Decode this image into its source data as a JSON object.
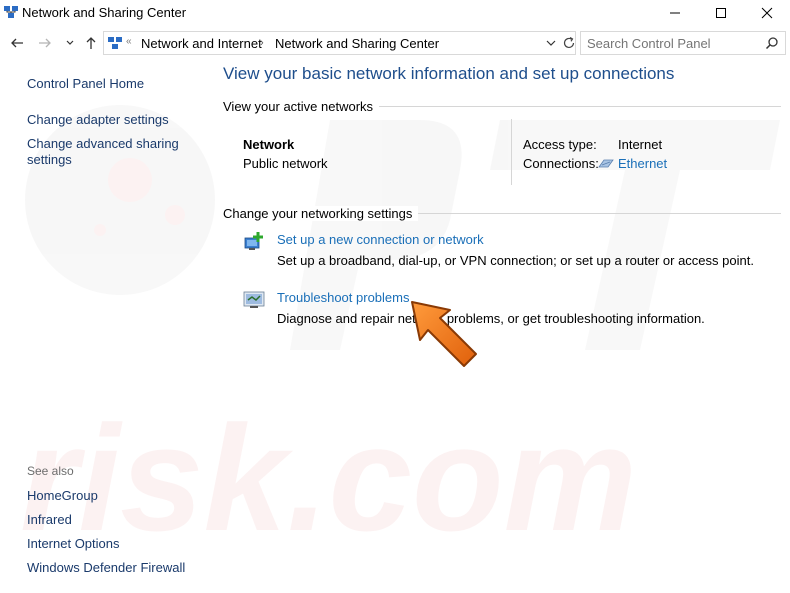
{
  "window": {
    "title": "Network and Sharing Center",
    "controls": [
      "minimize-icon",
      "maximize-icon",
      "close-icon"
    ]
  },
  "navigation": {
    "breadcrumb": [
      "Network and Internet",
      "Network and Sharing Center"
    ],
    "search_placeholder": "Search Control Panel"
  },
  "sidebar": {
    "home": "Control Panel Home",
    "links": [
      "Change adapter settings",
      "Change advanced sharing",
      "settings"
    ],
    "see_also_header": "See also",
    "see_also": [
      "HomeGroup",
      "Infrared",
      "Internet Options",
      "Windows Defender Firewall"
    ]
  },
  "main": {
    "title": "View your basic network information and set up connections",
    "active_networks_label": "View your active networks",
    "network": {
      "name": "Network",
      "type": "Public network",
      "access_type_label": "Access type:",
      "access_type_value": "Internet",
      "connections_label": "Connections:",
      "connections_value": "Ethernet"
    },
    "change_settings_label": "Change your networking settings",
    "tasks": [
      {
        "link": "Set up a new connection or network",
        "description": "Set up a broadband, dial-up, or VPN connection; or set up a router or access point."
      },
      {
        "link": "Troubleshoot problems",
        "description": "Diagnose and repair network problems, or get troubleshooting information."
      }
    ]
  },
  "colors": {
    "heading_blue": "#1e4e8c",
    "link_blue": "#1a6fb8",
    "annotation_arrow": "#f07a1a"
  }
}
